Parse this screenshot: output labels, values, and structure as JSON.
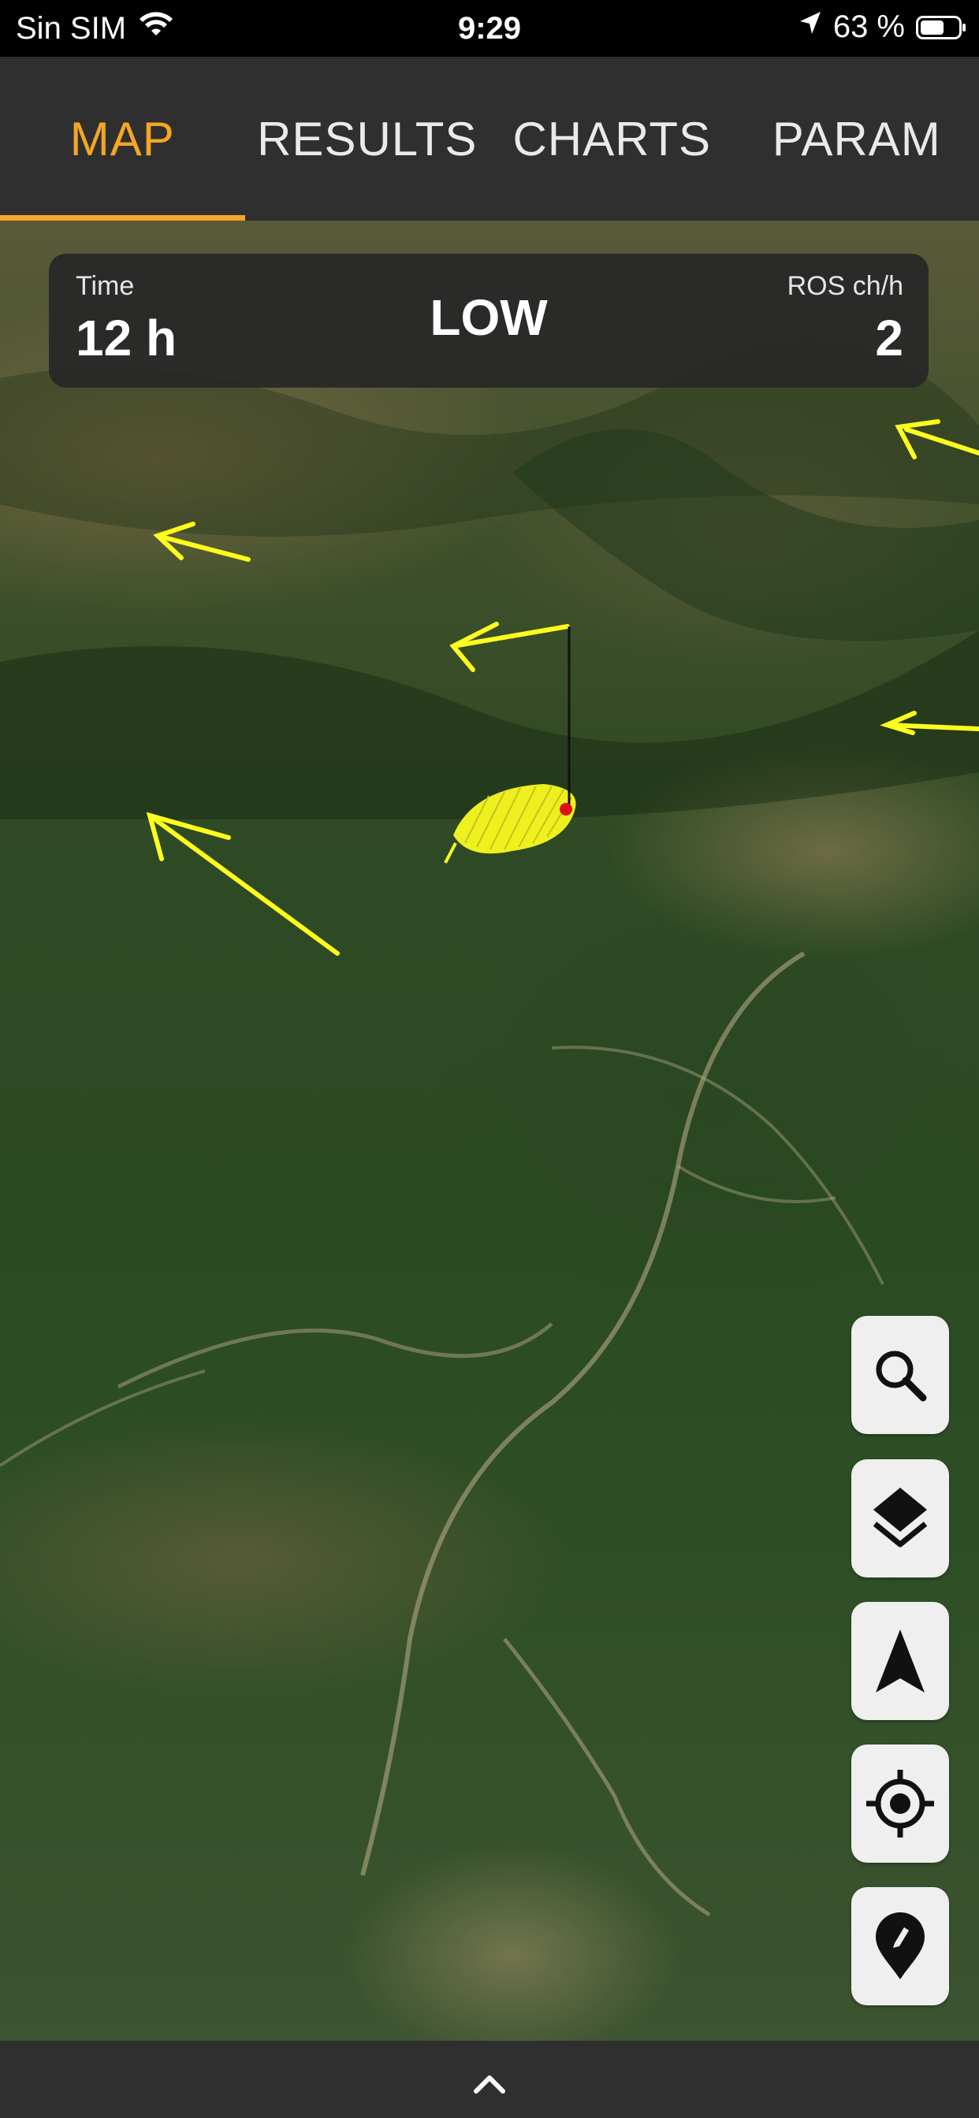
{
  "status_bar": {
    "carrier": "Sin SIM",
    "time": "9:29",
    "battery_percent": "63 %",
    "battery_level": 0.63
  },
  "tabs": [
    {
      "label": "MAP",
      "active": true
    },
    {
      "label": "RESULTS",
      "active": false
    },
    {
      "label": "CHARTS",
      "active": false
    },
    {
      "label": "PARAM",
      "active": false
    }
  ],
  "info_panel": {
    "time_label": "Time",
    "time_value": "12 h",
    "level": "LOW",
    "ros_label": "ROS ch/h",
    "ros_value": "2"
  },
  "map_controls": [
    {
      "name": "search-button",
      "icon": "search-icon"
    },
    {
      "name": "layers-button",
      "icon": "layers-icon"
    },
    {
      "name": "navigation-button",
      "icon": "navigation-arrow-icon"
    },
    {
      "name": "locate-button",
      "icon": "crosshair-icon"
    },
    {
      "name": "place-marker-button",
      "icon": "marker-pencil-icon"
    }
  ],
  "bottom_bar": {
    "icon": "chevron-up-icon"
  },
  "colors": {
    "accent": "#f5a623",
    "panel": "#2f2f2f",
    "wind_arrow": "#ffff1e",
    "fire_area": "#ffff1e",
    "ignition_point": "#e01010"
  }
}
